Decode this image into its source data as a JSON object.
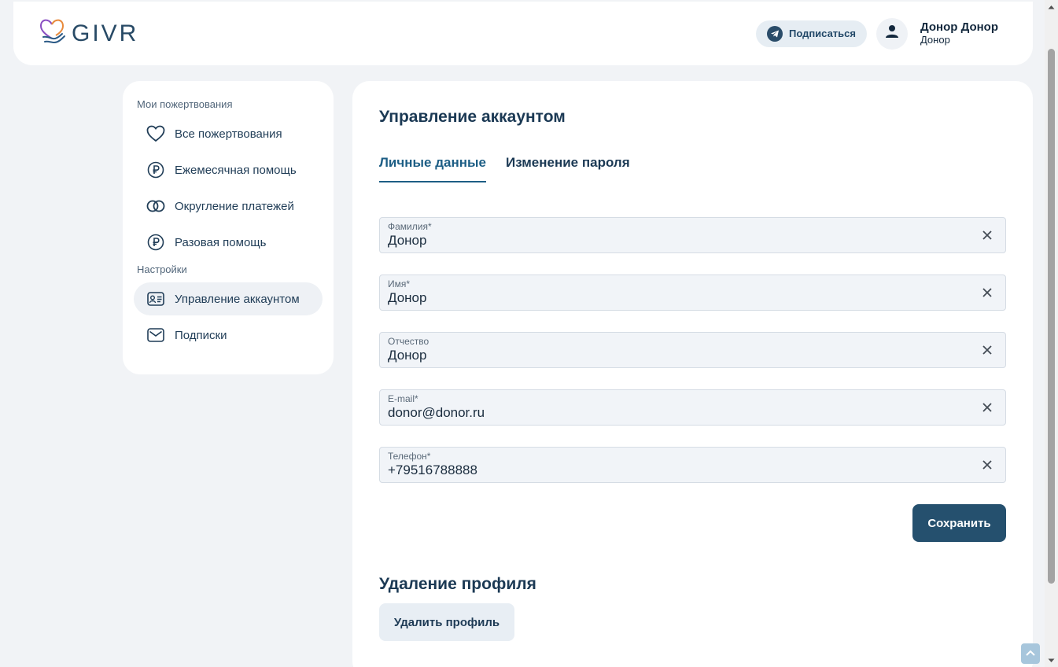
{
  "header": {
    "logo_text": "GIVR",
    "subscribe_label": "Подписаться",
    "user_name": "Донор Донор",
    "user_role": "Донор"
  },
  "sidebar": {
    "donations_section": "Мои пожертвования",
    "donation_items": [
      {
        "label": "Все пожертвования",
        "icon": "heart-icon"
      },
      {
        "label": "Ежемесячная помощь",
        "icon": "ruble-coin-icon"
      },
      {
        "label": "Округление платежей",
        "icon": "rings-icon"
      },
      {
        "label": "Разовая помощь",
        "icon": "ruble-coin-icon"
      }
    ],
    "settings_section": "Настройки",
    "settings_items": [
      {
        "label": "Управление аккаунтом",
        "icon": "id-card-icon",
        "active": true
      },
      {
        "label": "Подписки",
        "icon": "envelope-icon",
        "active": false
      }
    ]
  },
  "main": {
    "title": "Управление аккаунтом",
    "tabs": [
      {
        "label": "Личные данные",
        "active": true
      },
      {
        "label": "Изменение пароля",
        "active": false
      }
    ],
    "fields": [
      {
        "label": "Фамилия*",
        "value": "Донор"
      },
      {
        "label": "Имя*",
        "value": "Донор"
      },
      {
        "label": "Отчество",
        "value": "Донор"
      },
      {
        "label": "E-mail*",
        "value": "donor@donor.ru"
      },
      {
        "label": "Телефон*",
        "value": "+79516788888"
      }
    ],
    "save_label": "Сохранить",
    "delete_title": "Удаление профиля",
    "delete_label": "Удалить профиль"
  },
  "colors": {
    "accent": "#25506e",
    "tab_active": "#1d5e85",
    "background": "#f1f3f6"
  }
}
